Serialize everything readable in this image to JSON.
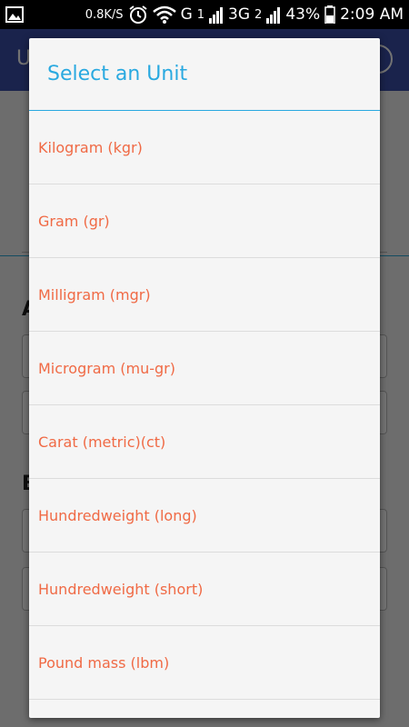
{
  "status_bar": {
    "net_speed": "0.8K/S",
    "sim1_network": "G",
    "sim1_index": "1",
    "sim2_network": "3G",
    "sim2_index": "2",
    "battery": "43%",
    "time": "2:09 AM",
    "icons": [
      "image-icon",
      "alarm-icon",
      "wifi-icon",
      "signal-icon",
      "battery-icon"
    ]
  },
  "app": {
    "title_fragment": "U",
    "section_fragment_1": "A",
    "section_fragment_2": "B"
  },
  "dialog": {
    "title": "Select an Unit",
    "items": [
      "Kilogram (kgr)",
      "Gram (gr)",
      "Milligram (mgr)",
      "Microgram (mu-gr)",
      "Carat (metric)(ct)",
      "Hundredweight (long)",
      "Hundredweight (short)",
      "Pound mass (lbm)"
    ]
  },
  "colors": {
    "accent_blue": "#29a9e0",
    "item_text": "#f06a45",
    "app_bar": "#3a4fa8"
  }
}
